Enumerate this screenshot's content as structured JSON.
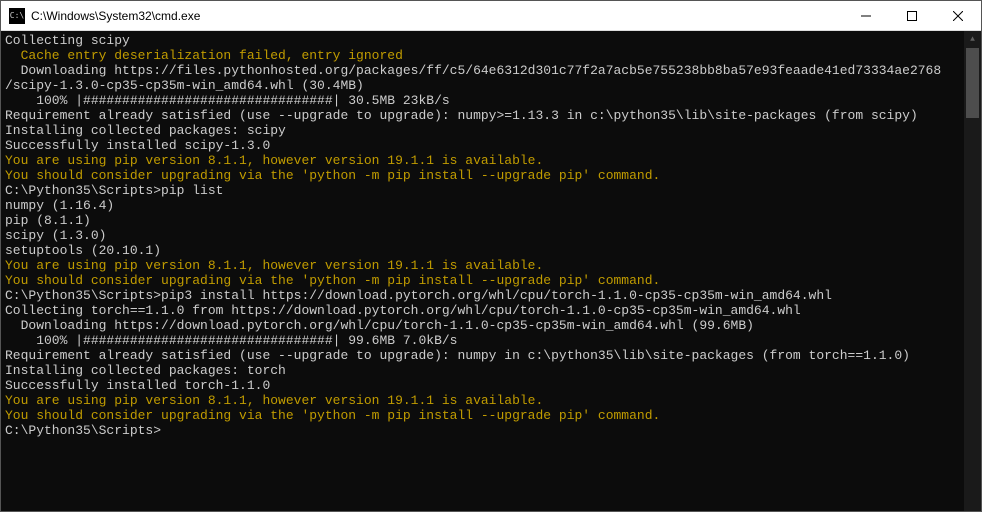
{
  "titlebar": {
    "icon_text": "C:\\",
    "title": "C:\\Windows\\System32\\cmd.exe"
  },
  "lines": [
    {
      "cls": "white",
      "text": "Collecting scipy"
    },
    {
      "cls": "yellow",
      "text": "  Cache entry deserialization failed, entry ignored"
    },
    {
      "cls": "white",
      "text": "  Downloading https://files.pythonhosted.org/packages/ff/c5/64e6312d301c77f2a7acb5e755238bb8ba57e93feaade41ed73334ae2768"
    },
    {
      "cls": "white",
      "text": "/scipy-1.3.0-cp35-cp35m-win_amd64.whl (30.4MB)"
    },
    {
      "cls": "white",
      "text": "    100% |################################| 30.5MB 23kB/s"
    },
    {
      "cls": "white",
      "text": "Requirement already satisfied (use --upgrade to upgrade): numpy>=1.13.3 in c:\\python35\\lib\\site-packages (from scipy)"
    },
    {
      "cls": "white",
      "text": "Installing collected packages: scipy"
    },
    {
      "cls": "white",
      "text": "Successfully installed scipy-1.3.0"
    },
    {
      "cls": "yellow",
      "text": "You are using pip version 8.1.1, however version 19.1.1 is available."
    },
    {
      "cls": "yellow",
      "text": "You should consider upgrading via the 'python -m pip install --upgrade pip' command."
    },
    {
      "cls": "white",
      "text": ""
    },
    {
      "cls": "prompt",
      "text": "C:\\Python35\\Scripts>pip list"
    },
    {
      "cls": "white",
      "text": "numpy (1.16.4)"
    },
    {
      "cls": "white",
      "text": "pip (8.1.1)"
    },
    {
      "cls": "white",
      "text": "scipy (1.3.0)"
    },
    {
      "cls": "white",
      "text": "setuptools (20.10.1)"
    },
    {
      "cls": "yellow",
      "text": "You are using pip version 8.1.1, however version 19.1.1 is available."
    },
    {
      "cls": "yellow",
      "text": "You should consider upgrading via the 'python -m pip install --upgrade pip' command."
    },
    {
      "cls": "white",
      "text": ""
    },
    {
      "cls": "prompt",
      "text": "C:\\Python35\\Scripts>pip3 install https://download.pytorch.org/whl/cpu/torch-1.1.0-cp35-cp35m-win_amd64.whl"
    },
    {
      "cls": "white",
      "text": "Collecting torch==1.1.0 from https://download.pytorch.org/whl/cpu/torch-1.1.0-cp35-cp35m-win_amd64.whl"
    },
    {
      "cls": "white",
      "text": "  Downloading https://download.pytorch.org/whl/cpu/torch-1.1.0-cp35-cp35m-win_amd64.whl (99.6MB)"
    },
    {
      "cls": "white",
      "text": "    100% |################################| 99.6MB 7.0kB/s"
    },
    {
      "cls": "white",
      "text": "Requirement already satisfied (use --upgrade to upgrade): numpy in c:\\python35\\lib\\site-packages (from torch==1.1.0)"
    },
    {
      "cls": "white",
      "text": "Installing collected packages: torch"
    },
    {
      "cls": "white",
      "text": "Successfully installed torch-1.1.0"
    },
    {
      "cls": "yellow",
      "text": "You are using pip version 8.1.1, however version 19.1.1 is available."
    },
    {
      "cls": "yellow",
      "text": "You should consider upgrading via the 'python -m pip install --upgrade pip' command."
    },
    {
      "cls": "white",
      "text": ""
    },
    {
      "cls": "prompt",
      "text": "C:\\Python35\\Scripts>"
    }
  ]
}
